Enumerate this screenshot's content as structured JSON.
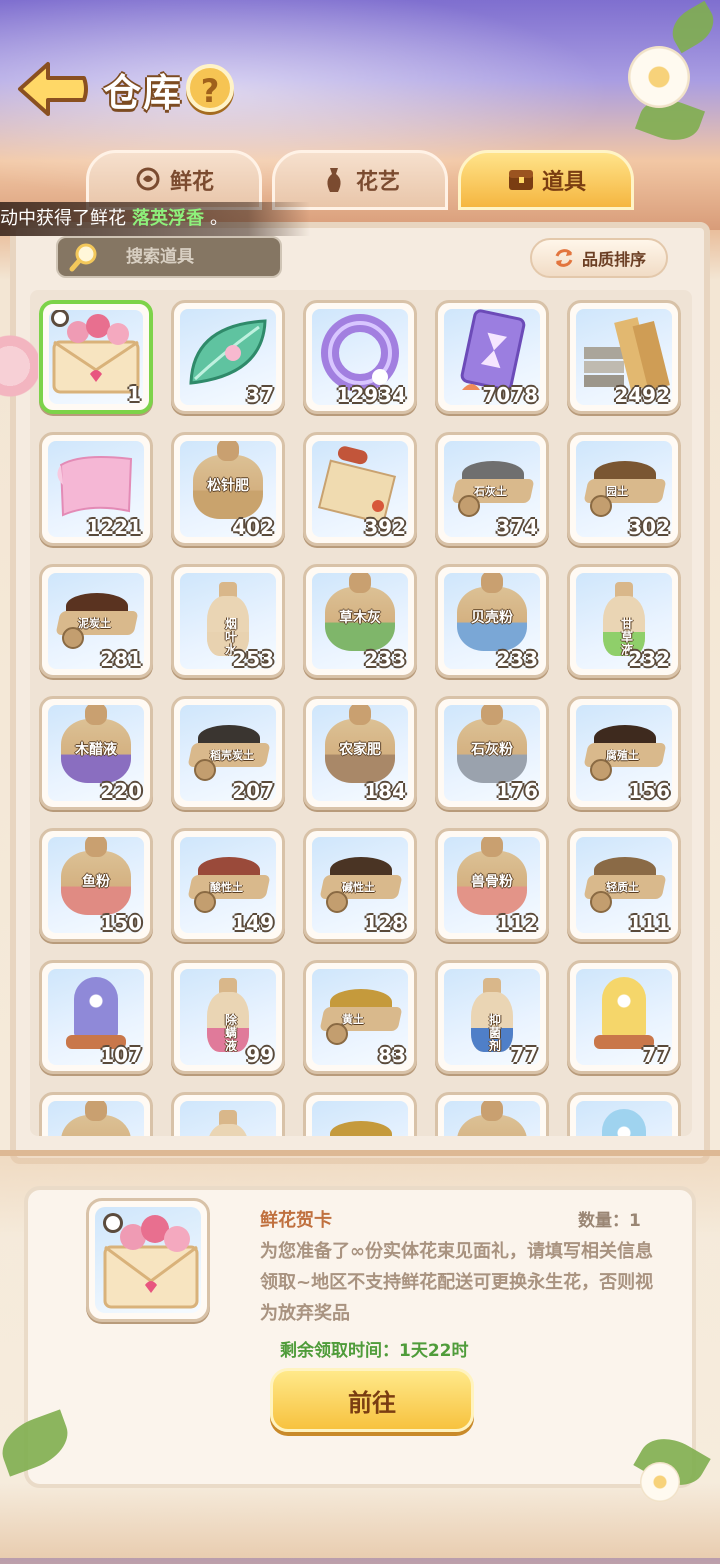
{
  "header": {
    "title": "仓库",
    "help_label": "?"
  },
  "tabs": [
    {
      "label": "鲜花",
      "active": false
    },
    {
      "label": "花艺",
      "active": false
    },
    {
      "label": "道具",
      "active": true
    }
  ],
  "toast": {
    "prefix": "动中获得了鲜花",
    "highlight": "落英浮香",
    "suffix": "。"
  },
  "search": {
    "placeholder": "搜索道具"
  },
  "sort_button": {
    "label": "品质排序"
  },
  "items": [
    {
      "name": "鲜花贺卡",
      "count": "1",
      "kind": "card",
      "selected": true
    },
    {
      "name": "leaf",
      "count": "37",
      "kind": "leaf"
    },
    {
      "name": "ring",
      "count": "12934",
      "kind": "ring"
    },
    {
      "name": "hourglass-card",
      "count": "7078",
      "kind": "tcard"
    },
    {
      "name": "planks",
      "count": "2492",
      "kind": "planks"
    },
    {
      "name": "cloth",
      "count": "1221",
      "kind": "cloth"
    },
    {
      "name": "松针肥",
      "count": "402",
      "kind": "bag",
      "label": "松针肥",
      "tint": "#c9a36d"
    },
    {
      "name": "scroll",
      "count": "392",
      "kind": "scroll"
    },
    {
      "name": "石灰土",
      "count": "374",
      "kind": "cart",
      "label": "石灰土",
      "pile": "#6f6f6f"
    },
    {
      "name": "园土",
      "count": "302",
      "kind": "cart",
      "label": "园土",
      "pile": "#7a5632"
    },
    {
      "name": "泥炭土",
      "count": "281",
      "kind": "cart",
      "label": "泥炭土",
      "pile": "#5a3320"
    },
    {
      "name": "烟叶水",
      "count": "253",
      "kind": "bottle",
      "label": "烟叶水",
      "liquid": "#e8d2b0"
    },
    {
      "name": "草木灰",
      "count": "233",
      "kind": "bag",
      "label": "草木灰",
      "tint": "#7fb66a"
    },
    {
      "name": "贝壳粉",
      "count": "233",
      "kind": "bag",
      "label": "贝壳粉",
      "tint": "#7aa7d6"
    },
    {
      "name": "甘草液",
      "count": "232",
      "kind": "bottle",
      "label": "甘草液",
      "liquid": "#8fcf6a"
    },
    {
      "name": "木醋液",
      "count": "220",
      "kind": "bag",
      "label": "木醋液",
      "tint": "#8a6ec0"
    },
    {
      "name": "稻壳炭土",
      "count": "207",
      "kind": "cart",
      "label": "稻壳炭土",
      "pile": "#3a3530"
    },
    {
      "name": "农家肥",
      "count": "184",
      "kind": "bag",
      "label": "农家肥",
      "tint": "#a98868"
    },
    {
      "name": "石灰粉",
      "count": "176",
      "kind": "bag",
      "label": "石灰粉",
      "tint": "#9aa2ad"
    },
    {
      "name": "腐殖土",
      "count": "156",
      "kind": "cart",
      "label": "腐殖土",
      "pile": "#3e2a1e"
    },
    {
      "name": "鱼粉",
      "count": "150",
      "kind": "bag",
      "label": "鱼粉",
      "tint": "#e08b83"
    },
    {
      "name": "酸性土",
      "count": "149",
      "kind": "cart",
      "label": "酸性土",
      "pile": "#9a4a3a"
    },
    {
      "name": "碱性土",
      "count": "128",
      "kind": "cart",
      "label": "碱性土",
      "pile": "#4a3424"
    },
    {
      "name": "兽骨粉",
      "count": "112",
      "kind": "bag",
      "label": "兽骨粉",
      "tint": "#e39488"
    },
    {
      "name": "轻质土",
      "count": "111",
      "kind": "cart",
      "label": "轻质土",
      "pile": "#8a6a46"
    },
    {
      "name": "moon-dome",
      "count": "107",
      "kind": "dome",
      "glass": "#8f89d8"
    },
    {
      "name": "除螨液",
      "count": "99",
      "kind": "bottle",
      "label": "除螨液",
      "liquid": "#e07a9a"
    },
    {
      "name": "黄土",
      "count": "83",
      "kind": "cart",
      "label": "黄土",
      "pile": "#c59a3c"
    },
    {
      "name": "抑菌剂",
      "count": "77",
      "kind": "bottle",
      "label": "抑菌剂",
      "liquid": "#4f7fc8"
    },
    {
      "name": "sun-dome",
      "count": "77",
      "kind": "dome",
      "glass": "#f5d66a"
    },
    {
      "name": "partial-1",
      "count": "",
      "kind": "bag",
      "label": "",
      "tint": "#c9a36d"
    },
    {
      "name": "partial-2",
      "count": "",
      "kind": "bottle",
      "label": "",
      "liquid": "#e8d2b0"
    },
    {
      "name": "partial-3",
      "count": "",
      "kind": "cart",
      "label": "",
      "pile": "#c59a3c"
    },
    {
      "name": "partial-4",
      "count": "",
      "kind": "bag",
      "label": "",
      "tint": "#c9a36d"
    },
    {
      "name": "partial-5",
      "count": "",
      "kind": "dome",
      "glass": "#9fd3ef"
    }
  ],
  "detail": {
    "name": "鲜花贺卡",
    "qty_label": "数量：1",
    "description": "为您准备了∞份实体花束见面礼，请填写相关信息领取~地区不支持鲜花配送可更换永生花，否则视为放弃奖品",
    "timer": "剩余领取时间：1天22时",
    "go_label": "前往"
  }
}
